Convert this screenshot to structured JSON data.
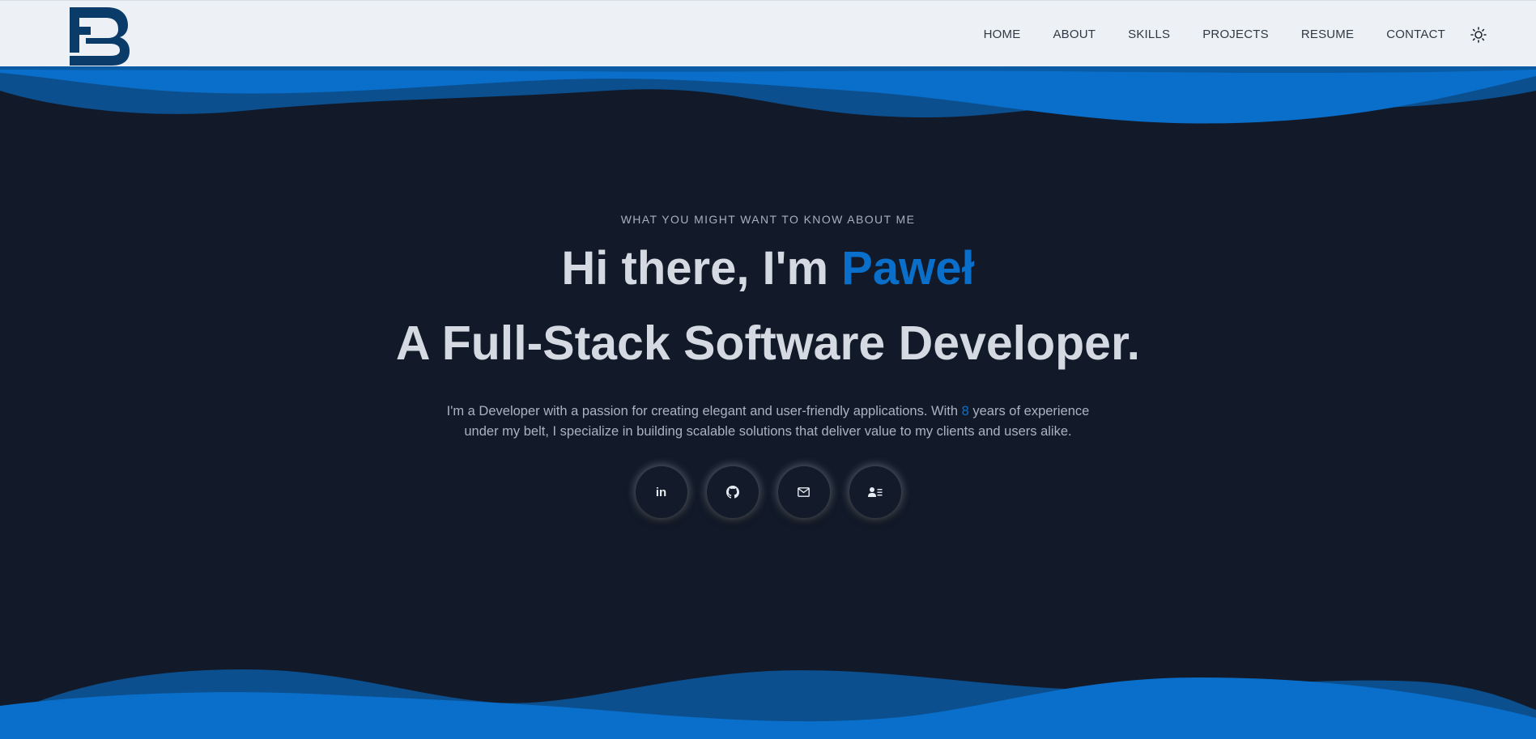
{
  "navbar": {
    "logo_alt": "PB",
    "links": [
      "HOME",
      "ABOUT",
      "SKILLS",
      "PROJECTS",
      "RESUME",
      "CONTACT"
    ],
    "theme_icon": "sun-icon"
  },
  "hero": {
    "eyebrow": "WHAT YOU MIGHT WANT TO KNOW ABOUT ME",
    "greeting": "Hi there, I'm ",
    "name": "Paweł",
    "subheadline": "A Full-Stack Software Developer.",
    "bio_before": "I'm a Developer with a passion for creating elegant and user-friendly applications. With ",
    "bio_years": "8",
    "bio_after": " years of experience under my belt, I specialize in building scalable solutions that deliver value to my clients and users alike."
  },
  "socials": {
    "linkedin_label": "in",
    "icons": [
      "linkedin-icon",
      "github-icon",
      "mail-icon",
      "contact-card-icon"
    ]
  },
  "colors": {
    "accent": "#0a6fca",
    "background": "#121a29",
    "navbar": "#edf1f5",
    "wave_dark": "#0b4f8f",
    "wave_light": "#0a6fca"
  }
}
